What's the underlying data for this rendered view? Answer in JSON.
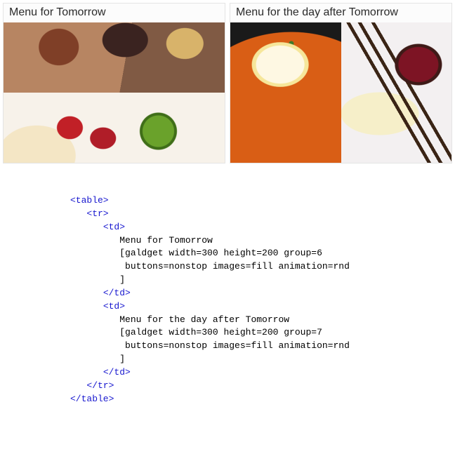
{
  "menu": {
    "cells": [
      {
        "title": "Menu for Tomorrow"
      },
      {
        "title": "Menu for the day after Tomorrow"
      }
    ]
  },
  "code": {
    "l01_tag": "<table>",
    "l02_tag": "<tr>",
    "l03_tag": "<td>",
    "l04_txt": "Menu for Tomorrow",
    "l05_txt": "[galdget width=300 height=200 group=6",
    "l06_txt": " buttons=nonstop images=fill animation=rnd",
    "l07_txt": "]",
    "l08_tag": "</td>",
    "l09_tag": "<td>",
    "l10_txt": "Menu for the day after Tomorrow",
    "l11_txt": "[galdget width=300 height=200 group=7",
    "l12_txt": " buttons=nonstop images=fill animation=rnd",
    "l13_txt": "]",
    "l14_tag": "</td>",
    "l15_tag": "</tr>",
    "l16_tag": "</table>"
  }
}
